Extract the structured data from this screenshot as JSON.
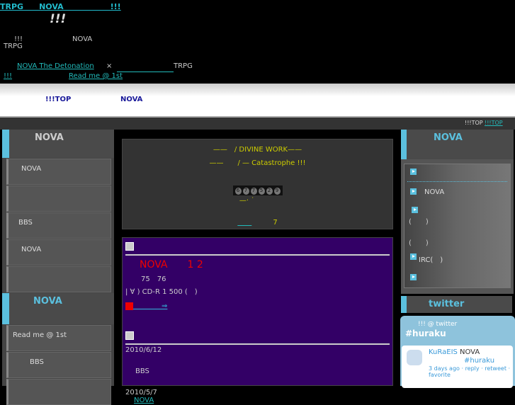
{
  "header": {
    "title_link": "TRPG　　NOVA　　　　　　!!!",
    "big": "!!!",
    "line1": "!!!　　　　　　　NOVA",
    "line2": "TRPG",
    "link_detonation": "NOVA The Detonation",
    "times": "×",
    "link_blank": "　　　　　　　　",
    "trpg": "TRPG",
    "link_bang": "!!!",
    "link_readme": "Read me @ 1st"
  },
  "nav": {
    "top": "!!!TOP",
    "nova": "NOVA"
  },
  "bar": {
    "top_text": "!!!TOP",
    "top_link": "!!!TOP"
  },
  "left": {
    "head1": "NOVA",
    "items1": [
      "NOVA",
      "",
      "BBS",
      "NOVA",
      ""
    ],
    "head2": "NOVA",
    "items2": [
      "Read me @ 1st",
      "BBS",
      ""
    ]
  },
  "info": {
    "line1": "——　/ DIVINE WORK——",
    "line2": "——　　/ — Catastrophe !!!",
    "counter": [
      "6",
      "7",
      "7",
      "5",
      "2",
      "9"
    ],
    "small": "—· ˙",
    "link": "　　",
    "seven": "7"
  },
  "news": {
    "title": "NOVA　　1 2",
    "sub": "75　76",
    "cdr": "| ∀ ) CD-R 1 500 (　)",
    "more_link": "　　　　⇒",
    "date1": "2010/6/12",
    "bbs": "BBS",
    "date2": "2010/5/7",
    "nova_link": "NOVA"
  },
  "right": {
    "head1": "NOVA",
    "links": [
      "",
      "NOVA",
      "",
      "(　　)",
      "(　　)",
      "IRC(　)",
      ""
    ],
    "head2": "twitter"
  },
  "twitter": {
    "caption": "!!! @ twitter",
    "hashtag": "#huraku",
    "user": "KuRaEIS",
    "text": "NOVA",
    "tag": "#huraku",
    "meta": "3 days ago · reply · retweet ·",
    "fav": "favorite"
  },
  "colors": {
    "accent": "#5bc0de",
    "link": "#22bbbb",
    "news_bg": "#330066",
    "yellow": "#cccc00"
  }
}
